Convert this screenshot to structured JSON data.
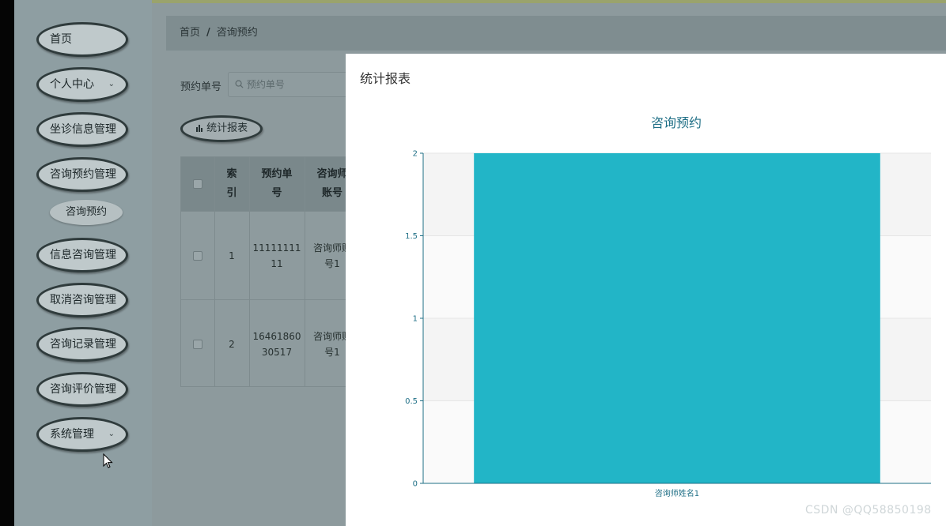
{
  "sidebar": {
    "items": [
      {
        "label": "首页"
      },
      {
        "label": "个人中心",
        "chevron": "⌄"
      },
      {
        "label": "坐诊信息管理"
      },
      {
        "label": "咨询预约管理"
      },
      {
        "label": "信息咨询管理"
      },
      {
        "label": "取消咨询管理"
      },
      {
        "label": "咨询记录管理"
      },
      {
        "label": "咨询评价管理"
      },
      {
        "label": "系统管理",
        "chevron": "⌄"
      }
    ],
    "sub_item": "咨询预约"
  },
  "breadcrumb": {
    "home": "首页",
    "sep": "/",
    "current": "咨询预约"
  },
  "search": {
    "label": "预约单号",
    "placeholder": "预约单号"
  },
  "report_button": {
    "label": "统计报表"
  },
  "table": {
    "headers": [
      "索引",
      "预约单号",
      "咨询师账号"
    ],
    "rows": [
      {
        "index": "1",
        "order": "11111111 11",
        "account": "咨询师账 号1"
      },
      {
        "index": "2",
        "order": "16461860 30517",
        "account": "咨询师账 号1"
      }
    ]
  },
  "modal": {
    "title": "统计报表"
  },
  "chart_data": {
    "type": "bar",
    "title": "咨询预约",
    "categories": [
      "咨询师姓名1"
    ],
    "values": [
      2
    ],
    "ylim": [
      0,
      2
    ],
    "yticks": [
      0,
      0.5,
      1,
      1.5,
      2
    ],
    "ytick_labels": [
      "0",
      "0.5",
      "1",
      "1.5",
      "2"
    ],
    "bar_color": "#22b5c7",
    "axis_color": "#1f6f86",
    "grid": true
  },
  "watermark": "CSDN @QQ58850198"
}
